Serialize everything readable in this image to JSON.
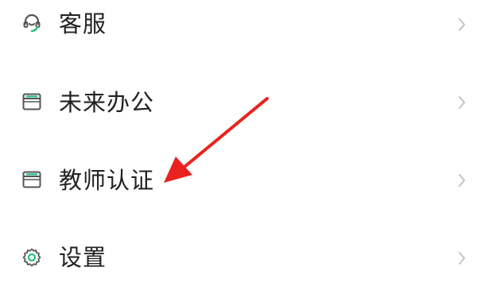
{
  "menu": {
    "items": [
      {
        "label": "客服",
        "icon": "headset-icon"
      },
      {
        "label": "未来办公",
        "icon": "window-icon"
      },
      {
        "label": "教师认证",
        "icon": "window-icon"
      },
      {
        "label": "设置",
        "icon": "gear-icon"
      }
    ]
  },
  "colors": {
    "accent_green": "#27c07d",
    "icon_gray": "#555555",
    "text": "#222222",
    "chevron": "#c4c4c4",
    "annotation_arrow": "#e8231f"
  }
}
